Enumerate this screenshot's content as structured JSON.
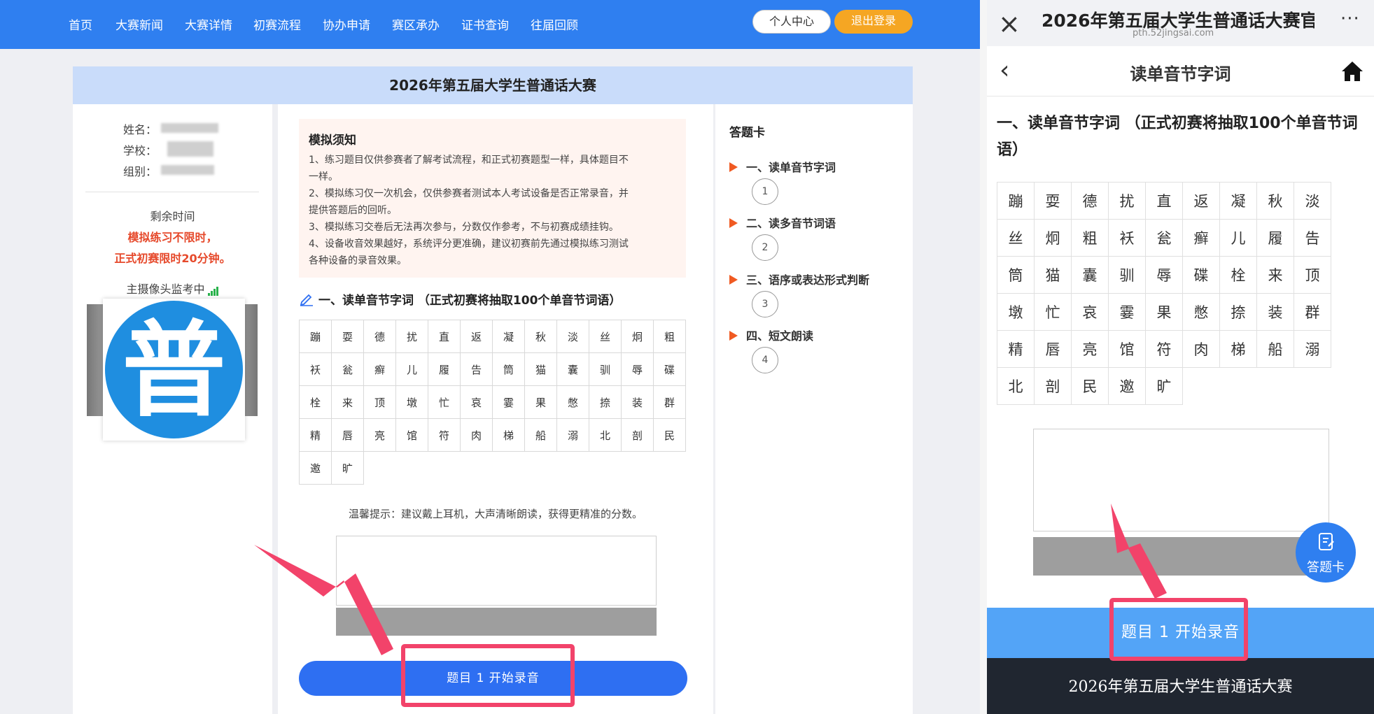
{
  "desktop": {
    "nav": {
      "items": [
        "首页",
        "大赛新闻",
        "大赛详情",
        "初赛流程",
        "协办申请",
        "赛区承办",
        "证书查询",
        "往届回顾"
      ],
      "profile_btn": "个人中心",
      "logout_btn": "退出登录"
    },
    "banner_title": "2026年第五届大学生普通话大赛",
    "user": {
      "name_label": "姓名：",
      "school_label": "学校：",
      "group_label": "组别："
    },
    "timer": {
      "label": "剩余时间",
      "line1": "模拟练习不限时，",
      "line2": "正式初赛限时20分钟。"
    },
    "camera_label": "主摄像头监考中",
    "logo_glyph": "普",
    "notice": {
      "title": "模拟须知",
      "lines": [
        "1、练习题目仅供参赛者了解考试流程，和正式初赛题型一样，具体题目不",
        "一样。",
        "2、模拟练习仅一次机会，仅供参赛者测试本人考试设备是否正常录音，并",
        "提供答题后的回听。",
        "3、模拟练习交卷后无法再次参与，分数仅作参考，不与初赛成绩挂钩。",
        "4、设备收音效果越好，系统评分更准确，建议初赛前先通过模拟练习测试",
        "各种设备的录音效果。"
      ]
    },
    "section_title": "一、读单音节字词 （正式初赛将抽取100个单音节词语）",
    "char_rows": [
      [
        "蹦",
        "耍",
        "德",
        "扰",
        "直",
        "返",
        "凝",
        "秋",
        "淡",
        "丝",
        "炯",
        "粗"
      ],
      [
        "袄",
        "瓮",
        "癣",
        "儿",
        "履",
        "告",
        "筒",
        "猫",
        "囊",
        "驯",
        "辱",
        "碟"
      ],
      [
        "栓",
        "来",
        "顶",
        "墩",
        "忙",
        "哀",
        "霎",
        "果",
        "憋",
        "捺",
        "装",
        "群"
      ],
      [
        "精",
        "唇",
        "亮",
        "馆",
        "符",
        "肉",
        "梯",
        "船",
        "溺",
        "北",
        "剖",
        "民"
      ],
      [
        "邀",
        "旷"
      ]
    ],
    "tip": "温馨提示：建议戴上耳机，大声清晰朗读，获得更精准的分数。",
    "record_btn": "题目 1 开始录音",
    "card": {
      "title": "答题卡",
      "sections": [
        {
          "label": "一、读单音节字词",
          "num": "1"
        },
        {
          "label": "二、读多音节词语",
          "num": "2"
        },
        {
          "label": "三、语序或表达形式判断",
          "num": "3"
        },
        {
          "label": "四、短文朗读",
          "num": "4"
        }
      ]
    }
  },
  "mobile": {
    "browser_title": "2026年第五届大学生普通话大赛官",
    "browser_url": "pth.52jingsai.com",
    "close_icon": "×",
    "more_icon": "···",
    "back_icon": "‹",
    "page_title": "读单音节字词",
    "section_title": "一、读单音节字词 （正式初赛将抽取100个单音节词语）",
    "char_rows": [
      [
        "蹦",
        "耍",
        "德",
        "扰",
        "直",
        "返",
        "凝",
        "秋",
        "淡"
      ],
      [
        "丝",
        "炯",
        "粗",
        "袄",
        "瓮",
        "癣",
        "儿",
        "履",
        "告"
      ],
      [
        "筒",
        "猫",
        "囊",
        "驯",
        "辱",
        "碟",
        "栓",
        "来",
        "顶"
      ],
      [
        "墩",
        "忙",
        "哀",
        "霎",
        "果",
        "憋",
        "捺",
        "装",
        "群"
      ],
      [
        "精",
        "唇",
        "亮",
        "馆",
        "符",
        "肉",
        "梯",
        "船",
        "溺"
      ],
      [
        "北",
        "剖",
        "民",
        "邀",
        "旷"
      ]
    ],
    "card_btn": "答题卡",
    "record_btn": "题目 1 开始录音",
    "footer": "2026年第五届大学生普通话大赛"
  },
  "colors": {
    "nav_blue": "#2f7ff0",
    "accent_orange": "#f5a623",
    "alert_red": "#e6492b",
    "highlight_pink": "#f2436a",
    "record_blue": "#2e6ff2"
  }
}
